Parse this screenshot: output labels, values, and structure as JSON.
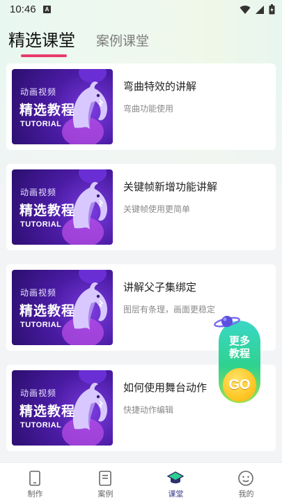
{
  "status_bar": {
    "time": "10:46",
    "notification_icon_letter": "A"
  },
  "tabs": [
    {
      "label": "精选课堂",
      "active": true
    },
    {
      "label": "案例课堂",
      "active": false
    }
  ],
  "thumbnail": {
    "line1": "动画视频",
    "line2": "精选教程",
    "line3": "TUTORIAL"
  },
  "lessons": [
    {
      "title": "弯曲特效的讲解",
      "subtitle": "弯曲功能使用"
    },
    {
      "title": "关键帧新增功能讲解",
      "subtitle": "关键帧使用更简单"
    },
    {
      "title": "讲解父子集绑定",
      "subtitle": "图层有条理，画面更稳定"
    },
    {
      "title": "如何使用舞台动作",
      "subtitle": "快捷动作编辑"
    }
  ],
  "floating_promo": {
    "line1": "更多",
    "line2": "教程",
    "go": "GO"
  },
  "bottom_nav": [
    {
      "label": "制作",
      "icon": "tablet-icon",
      "active": false
    },
    {
      "label": "案例",
      "icon": "document-icon",
      "active": false
    },
    {
      "label": "课堂",
      "icon": "graduation-cap-icon",
      "active": true
    },
    {
      "label": "我的",
      "icon": "smiley-icon",
      "active": false
    }
  ],
  "colors": {
    "accent": "#ea3a6b",
    "nav_active": "#3a3a8c",
    "thumb_purple": "#4a1ba3"
  }
}
